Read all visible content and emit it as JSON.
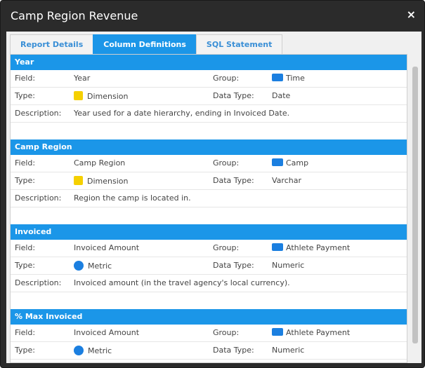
{
  "window": {
    "title": "Camp Region Revenue",
    "close_glyph": "×"
  },
  "tabs": [
    {
      "label": "Report Details",
      "active": false
    },
    {
      "label": "Column Definitions",
      "active": true
    },
    {
      "label": "SQL Statement",
      "active": false
    }
  ],
  "labels": {
    "field": "Field:",
    "type": "Type:",
    "group": "Group:",
    "data_type": "Data Type:",
    "description": "Description:"
  },
  "colors": {
    "accent": "#1b96e8",
    "dimension": "#f5d000",
    "metric": "#1b7fe0"
  },
  "sections": [
    {
      "header": "Year",
      "field": "Year",
      "group": "Time",
      "type": "Dimension",
      "type_icon": "dimension-square-icon",
      "data_type": "Date",
      "description": "Year used for a date hierarchy, ending in Invoiced Date."
    },
    {
      "header": "Camp Region",
      "field": "Camp Region",
      "group": "Camp",
      "type": "Dimension",
      "type_icon": "dimension-square-icon",
      "data_type": "Varchar",
      "description": "Region the camp is located in."
    },
    {
      "header": "Invoiced",
      "field": "Invoiced Amount",
      "group": "Athlete Payment",
      "type": "Metric",
      "type_icon": "metric-circle-icon",
      "data_type": "Numeric",
      "description": "Invoiced amount (in the travel agency's local currency)."
    },
    {
      "header": "% Max Invoiced",
      "field": "Invoiced Amount",
      "group": "Athlete Payment",
      "type": "Metric",
      "type_icon": "metric-circle-icon",
      "data_type": "Numeric",
      "description": ""
    }
  ]
}
